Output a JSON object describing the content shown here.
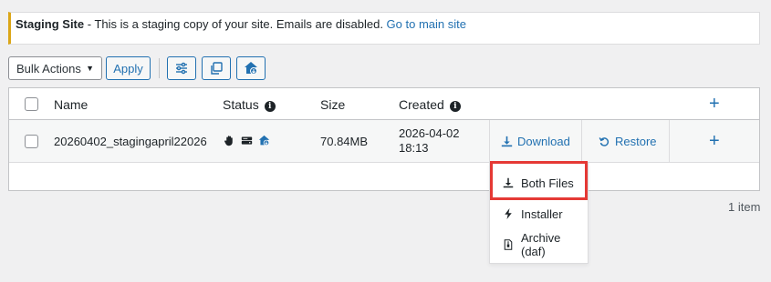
{
  "notice": {
    "title": "Staging Site",
    "message": " - This is a staging copy of your site. Emails are disabled. ",
    "link": "Go to main site"
  },
  "toolbar": {
    "bulk_actions": "Bulk Actions",
    "apply": "Apply",
    "icons": [
      "filter-settings-icon",
      "copy-icon",
      "home-cloud-icon"
    ]
  },
  "table": {
    "headers": {
      "name": "Name",
      "status": "Status",
      "size": "Size",
      "created": "Created"
    },
    "rows": [
      {
        "name": "20260402_stagingapril22026",
        "status_icons": [
          "hand-icon",
          "server-icon",
          "home-cloud-icon"
        ],
        "size": "70.84MB",
        "created_date": "2026-04-02",
        "created_time": "18:13",
        "download": "Download",
        "restore": "Restore"
      }
    ]
  },
  "pagination": {
    "count": "1 item"
  },
  "dropdown": {
    "items": [
      {
        "label": "Both Files",
        "icon": "download-icon"
      },
      {
        "label": "Installer",
        "icon": "bolt-icon"
      },
      {
        "label": "Archive (daf)",
        "icon": "file-archive-icon"
      }
    ]
  },
  "colors": {
    "accent": "#2271b1",
    "notice_border": "#dba617",
    "highlight": "#e53935"
  }
}
